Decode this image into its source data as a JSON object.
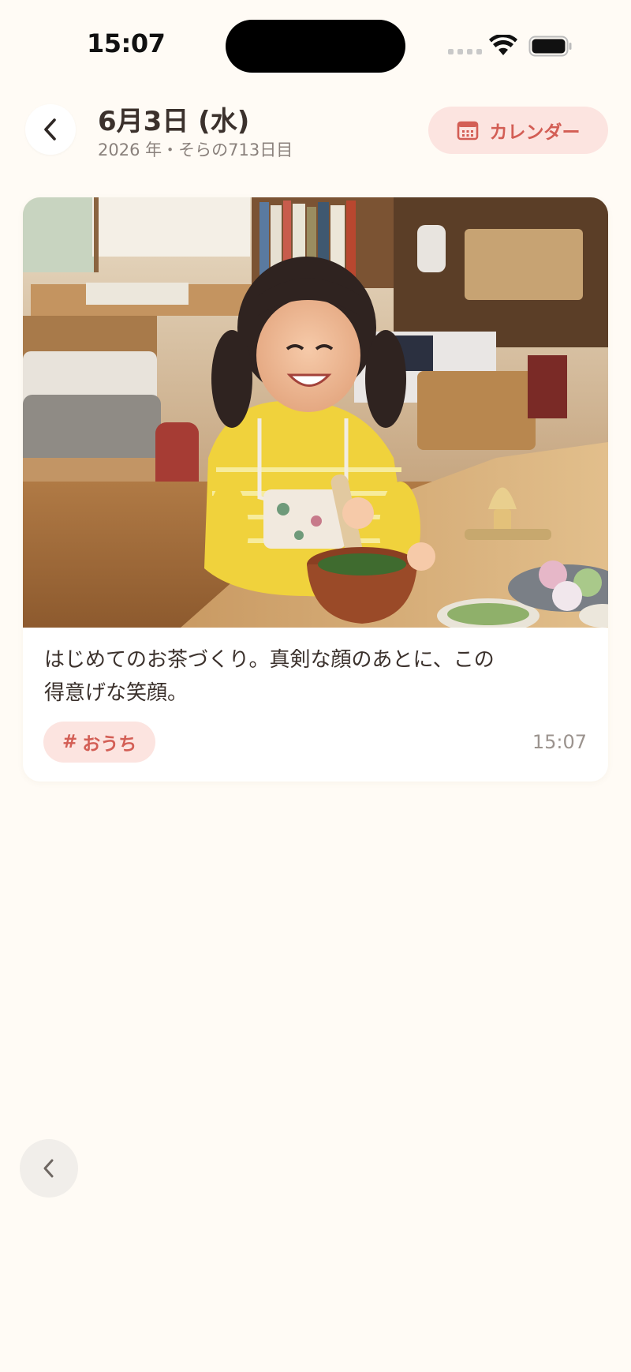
{
  "status_bar": {
    "time": "15:07"
  },
  "header": {
    "title": "6月3日 (水)",
    "subtitle": "2026 年・そらの713日目",
    "calendar_label": "カレンダー"
  },
  "entry": {
    "caption_line1": "はじめてのお茶づくり。真剣な顔のあとに、この",
    "caption_line2": "得意げな笑顔。",
    "tag_hash": "#",
    "tag_label": "おうち",
    "time": "15:07"
  },
  "colors": {
    "background": "#FFFBF5",
    "accent": "#D35E55",
    "accent_bg": "#FCE4E0"
  },
  "icons": {
    "back": "chevron-left-icon",
    "calendar": "calendar-icon",
    "wifi": "wifi-icon",
    "battery": "battery-icon"
  }
}
